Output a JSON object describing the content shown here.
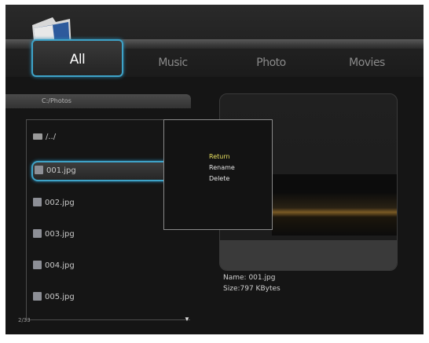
{
  "tabs": [
    {
      "label": "All",
      "active": true
    },
    {
      "label": "Music",
      "active": false
    },
    {
      "label": "Photo",
      "active": false
    },
    {
      "label": "Movies",
      "active": false
    }
  ],
  "browser": {
    "path": "C:/Photos",
    "items": [
      {
        "label": "/../",
        "icon": "folder-icon"
      },
      {
        "label": "001.jpg",
        "icon": "image-file-icon",
        "selected": true
      },
      {
        "label": "002.jpg",
        "icon": "image-file-icon"
      },
      {
        "label": "003.jpg",
        "icon": "image-file-icon"
      },
      {
        "label": "004.jpg",
        "icon": "image-file-icon"
      },
      {
        "label": "005.jpg",
        "icon": "image-file-icon"
      }
    ],
    "page_count": "2/33",
    "scroll_indicator": "▼"
  },
  "context_menu": {
    "items": [
      "Return",
      "Rename",
      "Delete"
    ],
    "highlighted": "Return"
  },
  "preview": {
    "name": "Name: 001.jpg",
    "size": "Size:797 KBytes"
  },
  "colors": {
    "accent": "#3ea3c8",
    "highlight_text": "#e8e060",
    "background": "#151515"
  }
}
